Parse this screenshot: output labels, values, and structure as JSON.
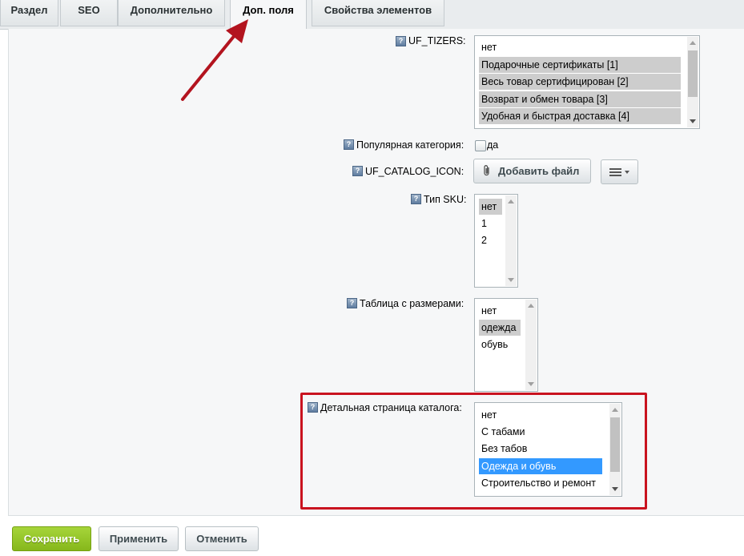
{
  "tabs": [
    "Раздел",
    "SEO",
    "Дополнительно",
    "Доп. поля",
    "Свойства элементов"
  ],
  "fields": {
    "tizers": {
      "label": "UF_TIZERS:",
      "options": [
        "нет",
        "Подарочные сертификаты [1]",
        "Весь товар сертифицирован [2]",
        "Возврат и обмен товара [3]",
        "Удобная и быстрая доставка [4]"
      ],
      "selected": [
        "Подарочные сертификаты [1]",
        "Весь товар сертифицирован [2]",
        "Возврат и обмен товара [3]",
        "Удобная и быстрая доставка [4]"
      ]
    },
    "popular": {
      "label": "Популярная категория:",
      "checkbox_label": "да",
      "checked": false
    },
    "catalog_icon": {
      "label": "UF_CATALOG_ICON:",
      "button_label": "Добавить файл"
    },
    "sku_type": {
      "label": "Тип SKU:",
      "options": [
        "нет",
        "1",
        "2"
      ],
      "selected": [
        "нет"
      ]
    },
    "size_table": {
      "label": "Таблица с размерами:",
      "options": [
        "нет",
        "одежда",
        "обувь"
      ],
      "selected": [
        "одежда"
      ]
    },
    "detail_page": {
      "label": "Детальная страница каталога:",
      "options": [
        "нет",
        "С табами",
        "Без табов",
        "Одежда и обувь",
        "Строительство и ремонт"
      ],
      "selected": [
        "Одежда и обувь"
      ]
    }
  },
  "help_icon": "?",
  "footer": {
    "save": "Сохранить",
    "apply": "Применить",
    "cancel": "Отменить"
  },
  "colors": {
    "annotation_red": "#c9131f",
    "selection_blue": "#3399ff",
    "selection_grey": "#cdcdcd",
    "save_green": "#86b71b"
  }
}
